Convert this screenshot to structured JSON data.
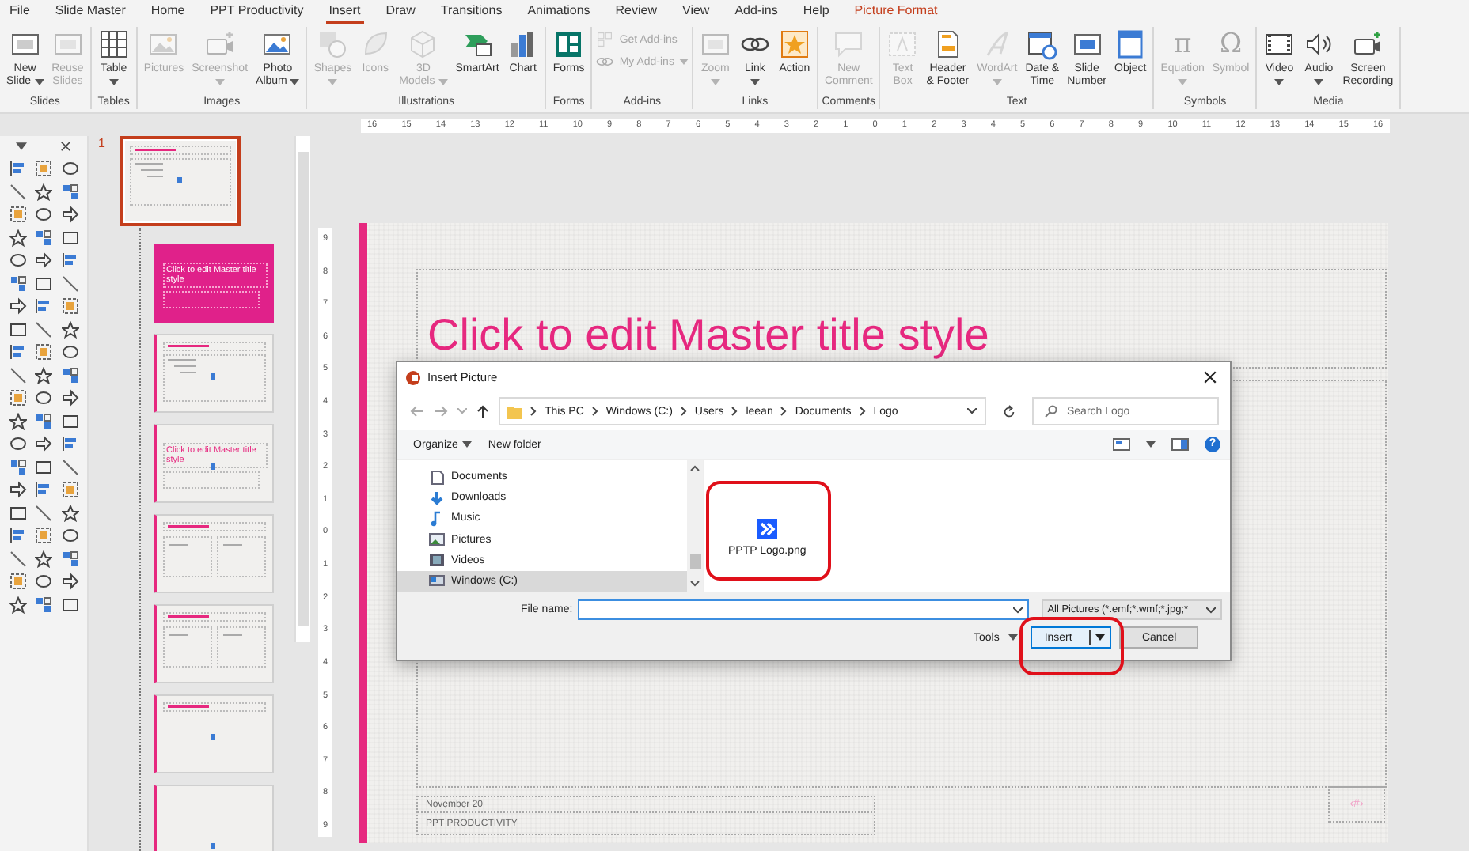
{
  "tabs": [
    {
      "label": "File",
      "selected": false,
      "kind": "normal"
    },
    {
      "label": "Slide Master",
      "selected": false,
      "kind": "normal"
    },
    {
      "label": "Home",
      "selected": false,
      "kind": "normal"
    },
    {
      "label": "PPT Productivity",
      "selected": false,
      "kind": "normal"
    },
    {
      "label": "Insert",
      "selected": true,
      "kind": "normal"
    },
    {
      "label": "Draw",
      "selected": false,
      "kind": "normal"
    },
    {
      "label": "Transitions",
      "selected": false,
      "kind": "normal"
    },
    {
      "label": "Animations",
      "selected": false,
      "kind": "normal"
    },
    {
      "label": "Review",
      "selected": false,
      "kind": "normal"
    },
    {
      "label": "View",
      "selected": false,
      "kind": "normal"
    },
    {
      "label": "Add-ins",
      "selected": false,
      "kind": "normal"
    },
    {
      "label": "Help",
      "selected": false,
      "kind": "normal"
    },
    {
      "label": "Picture Format",
      "selected": false,
      "kind": "contextual"
    }
  ],
  "ribbon_groups": [
    {
      "label": "Slides",
      "buttons": [
        {
          "kind": "large",
          "label": [
            "New",
            "Slide"
          ],
          "dropdown": true,
          "disabled": false
        },
        {
          "kind": "large",
          "label": [
            "Reuse",
            "Slides"
          ],
          "disabled": true
        }
      ]
    },
    {
      "label": "Tables",
      "buttons": [
        {
          "kind": "large",
          "label": [
            "Table"
          ],
          "dropdown": true,
          "disabled": false
        }
      ]
    },
    {
      "label": "Images",
      "buttons": [
        {
          "kind": "large",
          "label": [
            "Pictures"
          ],
          "disabled": true
        },
        {
          "kind": "large",
          "label": [
            "Screenshot"
          ],
          "dropdown": true,
          "disabled": true
        },
        {
          "kind": "large",
          "label": [
            "Photo",
            "Album"
          ],
          "dropdown": true,
          "disabled": false
        }
      ]
    },
    {
      "label": "Illustrations",
      "buttons": [
        {
          "kind": "large",
          "label": [
            "Shapes"
          ],
          "dropdown": true,
          "disabled": true
        },
        {
          "kind": "large",
          "label": [
            "Icons"
          ],
          "disabled": true
        },
        {
          "kind": "large",
          "label": [
            "3D",
            "Models"
          ],
          "dropdown": true,
          "disabled": true
        },
        {
          "kind": "large",
          "label": [
            "SmartArt"
          ],
          "disabled": false
        },
        {
          "kind": "large",
          "label": [
            "Chart"
          ],
          "disabled": false
        }
      ]
    },
    {
      "label": "Forms",
      "buttons": [
        {
          "kind": "large",
          "label": [
            "Forms"
          ],
          "disabled": false
        }
      ]
    },
    {
      "label": "Add-ins",
      "buttons": [
        {
          "kind": "small",
          "label": [
            "Get Add-ins"
          ],
          "disabled": true
        },
        {
          "kind": "small",
          "label": [
            "My Add-ins"
          ],
          "dropdown": true,
          "disabled": true
        }
      ]
    },
    {
      "label": "Links",
      "buttons": [
        {
          "kind": "large",
          "label": [
            "Zoom"
          ],
          "dropdown": true,
          "disabled": true
        },
        {
          "kind": "large",
          "label": [
            "Link"
          ],
          "dropdown": true,
          "disabled": false
        },
        {
          "kind": "large",
          "label": [
            "Action"
          ],
          "disabled": false
        }
      ]
    },
    {
      "label": "Comments",
      "buttons": [
        {
          "kind": "large",
          "label": [
            "New",
            "Comment"
          ],
          "disabled": true
        }
      ]
    },
    {
      "label": "Text",
      "buttons": [
        {
          "kind": "large",
          "label": [
            "Text",
            "Box"
          ],
          "disabled": true
        },
        {
          "kind": "large",
          "label": [
            "Header",
            "& Footer"
          ],
          "disabled": false
        },
        {
          "kind": "large",
          "label": [
            "WordArt"
          ],
          "dropdown": true,
          "disabled": true
        },
        {
          "kind": "large",
          "label": [
            "Date &",
            "Time"
          ],
          "disabled": false
        },
        {
          "kind": "large",
          "label": [
            "Slide",
            "Number"
          ],
          "disabled": false
        },
        {
          "kind": "large",
          "label": [
            "Object"
          ],
          "disabled": false
        }
      ]
    },
    {
      "label": "Symbols",
      "buttons": [
        {
          "kind": "glyph",
          "glyph": "π",
          "label": [
            "Equation"
          ],
          "dropdown": true,
          "disabled": true
        },
        {
          "kind": "glyph",
          "glyph": "Ω",
          "label": [
            "Symbol"
          ],
          "disabled": true
        }
      ]
    },
    {
      "label": "Media",
      "buttons": [
        {
          "kind": "large",
          "label": [
            "Video"
          ],
          "dropdown": true,
          "disabled": false
        },
        {
          "kind": "large",
          "label": [
            "Audio"
          ],
          "dropdown": true,
          "disabled": false
        },
        {
          "kind": "large",
          "label": [
            "Screen",
            "Recording"
          ],
          "disabled": false
        }
      ]
    }
  ],
  "ruler": {
    "horizontal": [
      "16",
      "15",
      "14",
      "13",
      "12",
      "11",
      "10",
      "9",
      "8",
      "7",
      "6",
      "5",
      "4",
      "3",
      "2",
      "1",
      "0",
      "1",
      "2",
      "3",
      "4",
      "5",
      "6",
      "7",
      "8",
      "9",
      "10",
      "11",
      "12",
      "13",
      "14",
      "15",
      "16"
    ],
    "vertical": [
      "9",
      "8",
      "7",
      "6",
      "5",
      "4",
      "3",
      "2",
      "1",
      "0",
      "1",
      "2",
      "3",
      "4",
      "5",
      "6",
      "7",
      "8",
      "9"
    ]
  },
  "thumbnails": [
    {
      "number": "1",
      "selected": true,
      "kind": "master"
    },
    {
      "selected": false,
      "kind": "title",
      "title": "Click to edit Master title style"
    },
    {
      "selected": false,
      "kind": "content"
    },
    {
      "selected": false,
      "kind": "section",
      "title": "Click to edit Master title style"
    },
    {
      "selected": false,
      "kind": "two-content"
    },
    {
      "selected": false,
      "kind": "comparison"
    },
    {
      "selected": false,
      "kind": "title-only"
    },
    {
      "selected": false,
      "kind": "blank"
    }
  ],
  "slide": {
    "title": "Click to edit Master title style",
    "footer_date": "November 20",
    "footer_text": "PPT PRODUCTIVITY",
    "slide_number": "‹#›"
  },
  "dialog": {
    "title": "Insert Picture",
    "path": [
      "This PC",
      "Windows (C:)",
      "Users",
      "leean",
      "Documents",
      "Logo"
    ],
    "search": {
      "placeholder": "Search Logo"
    },
    "toolbar": {
      "organize": "Organize",
      "new_folder": "New folder",
      "help": "?"
    },
    "tree": [
      {
        "label": "Documents",
        "selected": false
      },
      {
        "label": "Downloads",
        "selected": false
      },
      {
        "label": "Music",
        "selected": false
      },
      {
        "label": "Pictures",
        "selected": false
      },
      {
        "label": "Videos",
        "selected": false
      },
      {
        "label": "Windows (C:)",
        "selected": true
      }
    ],
    "files": [
      {
        "name": "PPTP Logo.png",
        "highlighted": true
      }
    ],
    "file_name_label": "File name:",
    "file_type": "All Pictures (*.emf;*.wmf;*.jpg;*",
    "tools": "Tools",
    "insert": {
      "label": "Insert",
      "highlighted": true
    },
    "cancel": "Cancel"
  }
}
